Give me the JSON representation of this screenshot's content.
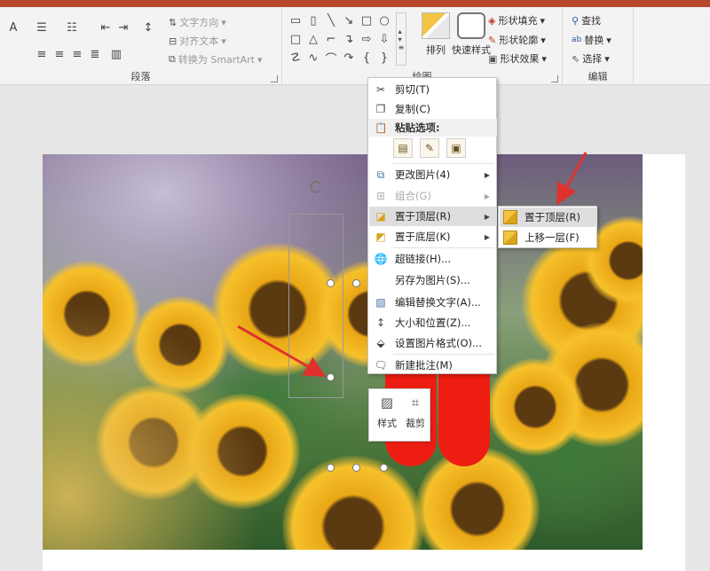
{
  "ribbon": {
    "paragraph": {
      "label": "段落",
      "text_direction": "文字方向",
      "align_text": "对齐文本",
      "convert_smartart": "转换为 SmartArt"
    },
    "drawing": {
      "label": "绘图",
      "arrange": "排列",
      "quick_styles": "快速样式",
      "shape_fill": "形状填充",
      "shape_outline": "形状轮廓",
      "shape_effects": "形状效果"
    },
    "editing": {
      "label": "编辑",
      "find": "查找",
      "replace": "替换",
      "select": "选择"
    }
  },
  "context_menu": {
    "cut": "剪切(T)",
    "copy": "复制(C)",
    "paste_options": "粘贴选项:",
    "change_picture": "更改图片(4)",
    "group": "组合(G)",
    "bring_to_front": "置于顶层(R)",
    "send_to_back": "置于底层(K)",
    "hyperlink": "超链接(H)...",
    "save_as_picture": "另存为图片(S)...",
    "edit_alt_text": "编辑替换文字(A)...",
    "size_position": "大小和位置(Z)...",
    "format_picture": "设置图片格式(O)...",
    "new_comment": "新建批注(M)"
  },
  "submenu": {
    "bring_to_front": "置于顶层(R)",
    "bring_forward": "上移一层(F)"
  },
  "mini_toolbar": {
    "style": "样式",
    "crop": "裁剪"
  },
  "colors": {
    "accent": "#b7472a",
    "arrow": "#e0322c",
    "shape_red": "#ee1d12"
  }
}
